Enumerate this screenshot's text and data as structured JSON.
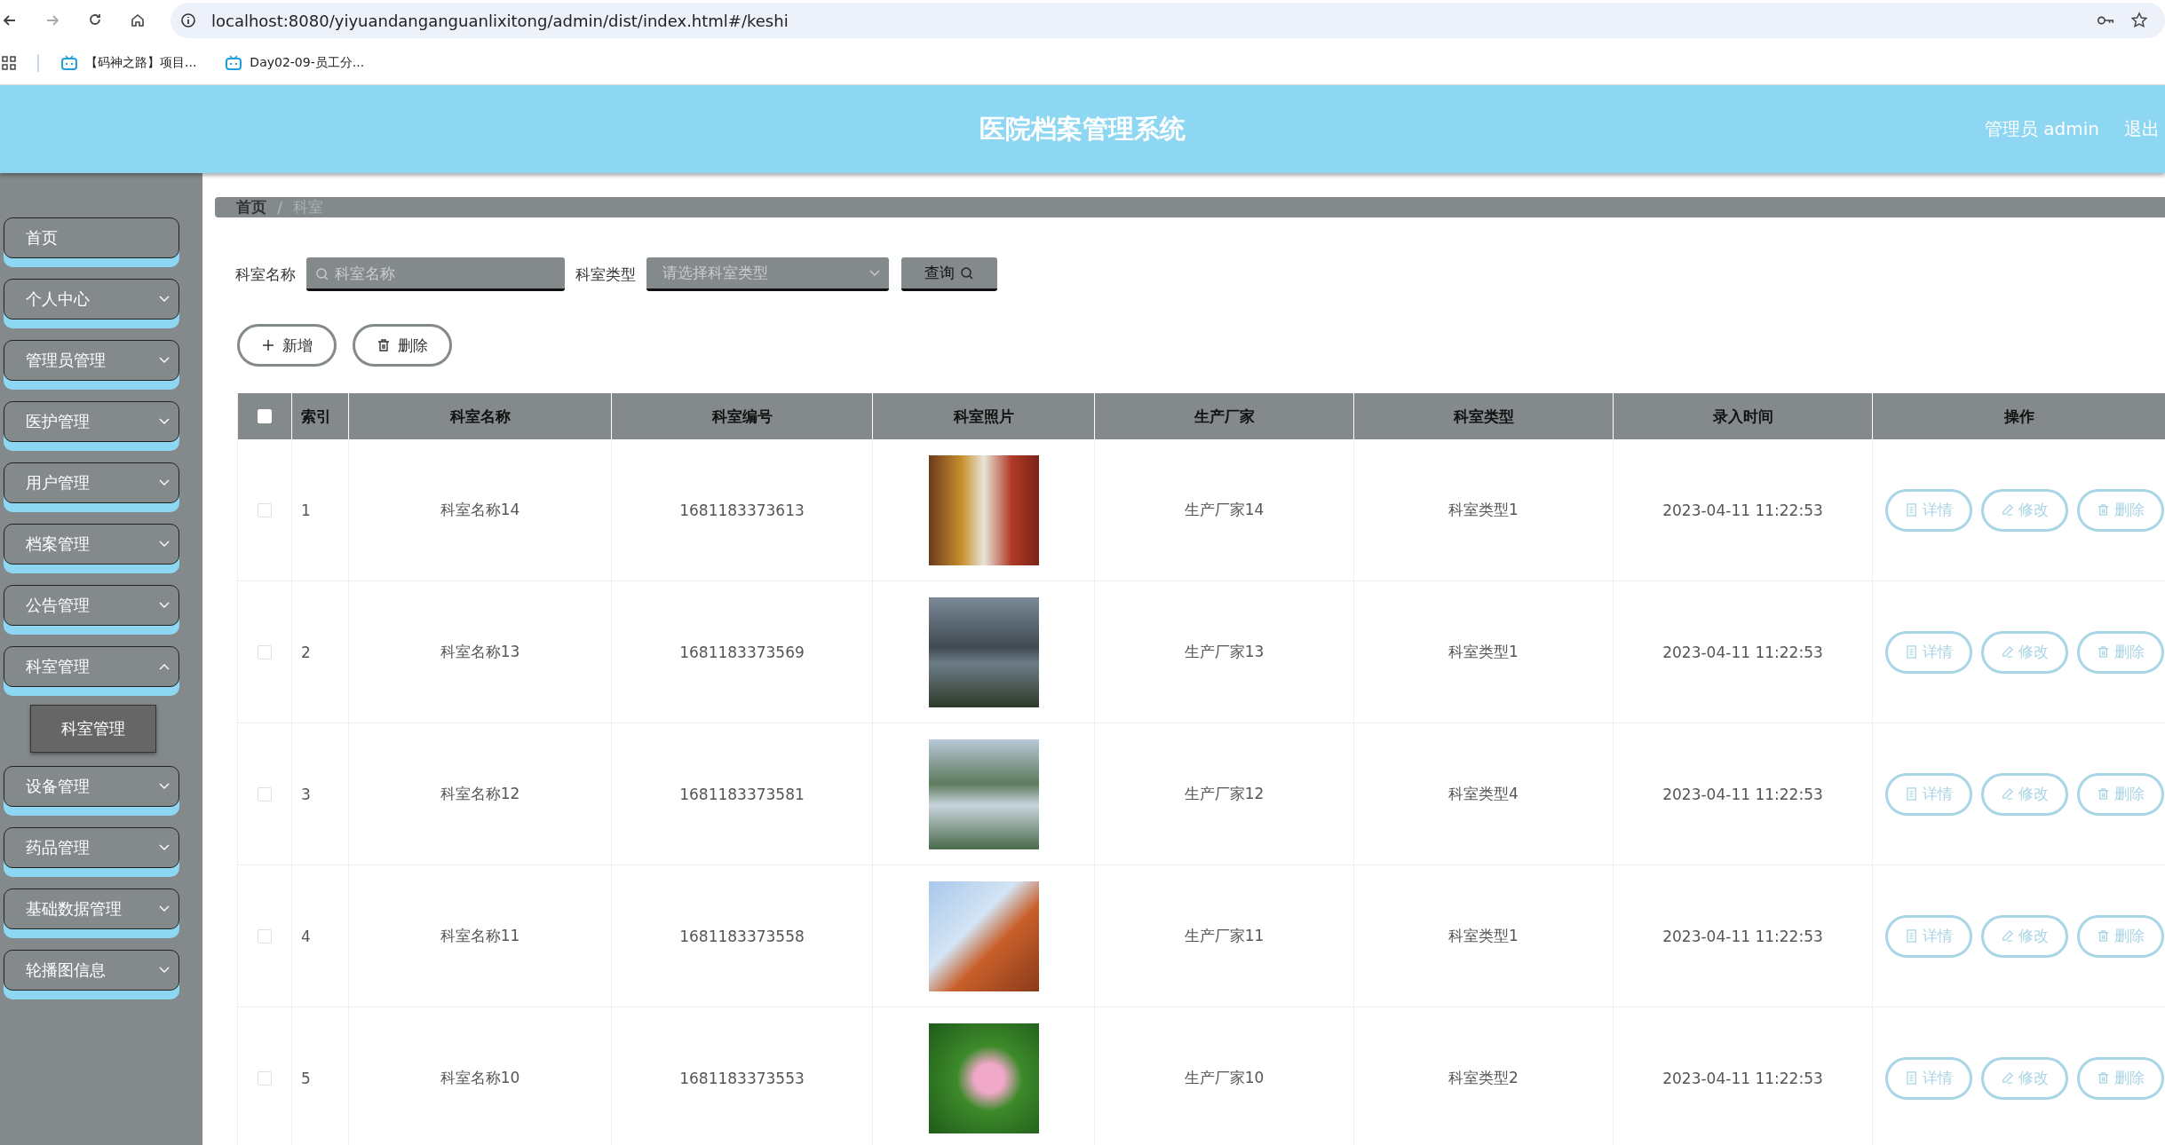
{
  "browser": {
    "url": "localhost:8080/yiyuandanganguanlixitong/admin/dist/index.html#/keshi",
    "bookmarks": [
      "【码神之路】项目...",
      "Day02-09-员工分..."
    ]
  },
  "header": {
    "title": "医院档案管理系统",
    "user": "管理员 admin",
    "logout": "退出"
  },
  "sidebar": {
    "items": [
      {
        "kind": "link",
        "label": "首页"
      },
      {
        "kind": "menu",
        "label": "个人中心",
        "expanded": false
      },
      {
        "kind": "menu",
        "label": "管理员管理",
        "expanded": false
      },
      {
        "kind": "menu",
        "label": "医护管理",
        "expanded": false
      },
      {
        "kind": "menu",
        "label": "用户管理",
        "expanded": false
      },
      {
        "kind": "menu",
        "label": "档案管理",
        "expanded": false
      },
      {
        "kind": "menu",
        "label": "公告管理",
        "expanded": false
      },
      {
        "kind": "menu",
        "label": "科室管理",
        "expanded": true,
        "children": [
          {
            "label": "科室管理",
            "selected": true
          }
        ]
      },
      {
        "kind": "menu",
        "label": "设备管理",
        "expanded": false
      },
      {
        "kind": "menu",
        "label": "药品管理",
        "expanded": false
      },
      {
        "kind": "menu",
        "label": "基础数据管理",
        "expanded": false
      },
      {
        "kind": "menu",
        "label": "轮播图信息",
        "expanded": false
      }
    ]
  },
  "breadcrumb": {
    "separator": "/",
    "items": [
      "首页",
      "科室"
    ]
  },
  "filters": {
    "name_label": "科室名称",
    "name_placeholder": "科室名称",
    "type_label": "科室类型",
    "type_placeholder": "请选择科室类型",
    "query_button": "查询"
  },
  "actions": [
    "新增",
    "删除"
  ],
  "table": {
    "select_all_checked": false,
    "columns": [
      "索引",
      "科室名称",
      "科室编号",
      "科室照片",
      "生产厂家",
      "科室类型",
      "录入时间",
      "操作"
    ],
    "rows": [
      {
        "checked": false,
        "index": "1",
        "name": "科室名称14",
        "code": "1681183373613",
        "maker": "生产厂家14",
        "type": "科室类型1",
        "time": "2023-04-11 11:22:53",
        "buttons": [
          "详情",
          "修改",
          "删除"
        ]
      },
      {
        "checked": false,
        "index": "2",
        "name": "科室名称13",
        "code": "1681183373569",
        "maker": "生产厂家13",
        "type": "科室类型1",
        "time": "2023-04-11 11:22:53",
        "buttons": [
          "详情",
          "修改",
          "删除"
        ]
      },
      {
        "checked": false,
        "index": "3",
        "name": "科室名称12",
        "code": "1681183373581",
        "maker": "生产厂家12",
        "type": "科室类型4",
        "time": "2023-04-11 11:22:53",
        "buttons": [
          "详情",
          "修改",
          "删除"
        ]
      },
      {
        "checked": false,
        "index": "4",
        "name": "科室名称11",
        "code": "1681183373558",
        "maker": "生产厂家11",
        "type": "科室类型1",
        "time": "2023-04-11 11:22:53",
        "buttons": [
          "详情",
          "修改",
          "删除"
        ]
      },
      {
        "checked": false,
        "index": "5",
        "name": "科室名称10",
        "code": "1681183373553",
        "maker": "生产厂家10",
        "type": "科室类型2",
        "time": "2023-04-11 11:22:53",
        "buttons": [
          "详情",
          "修改",
          "删除"
        ]
      }
    ]
  }
}
